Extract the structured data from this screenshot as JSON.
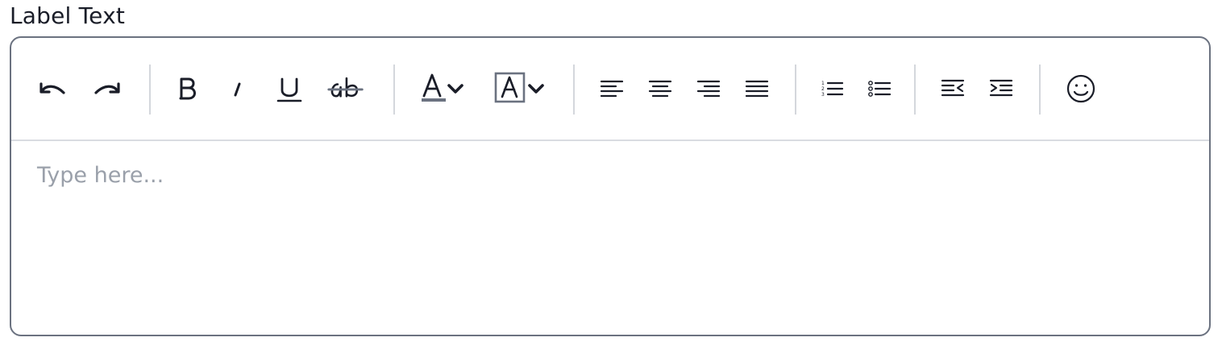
{
  "field": {
    "label": "Label Text"
  },
  "editor": {
    "placeholder": "Type here..."
  },
  "toolbar": {
    "groups": [
      [
        "undo",
        "redo"
      ],
      [
        "bold",
        "italic",
        "underline",
        "strikethrough"
      ],
      [
        "text-color",
        "highlight-color"
      ],
      [
        "align-left",
        "align-center",
        "align-right",
        "align-justify"
      ],
      [
        "ordered-list",
        "bullet-list"
      ],
      [
        "outdent",
        "indent"
      ],
      [
        "emoji"
      ]
    ],
    "icon_color": "#1a1d28",
    "text_color_bar": "#6b7280",
    "highlight_box_color": "#6b7280"
  },
  "colors": {
    "border": "#6b7280",
    "divider": "#d9dce1",
    "placeholder": "#9aa0aa"
  }
}
